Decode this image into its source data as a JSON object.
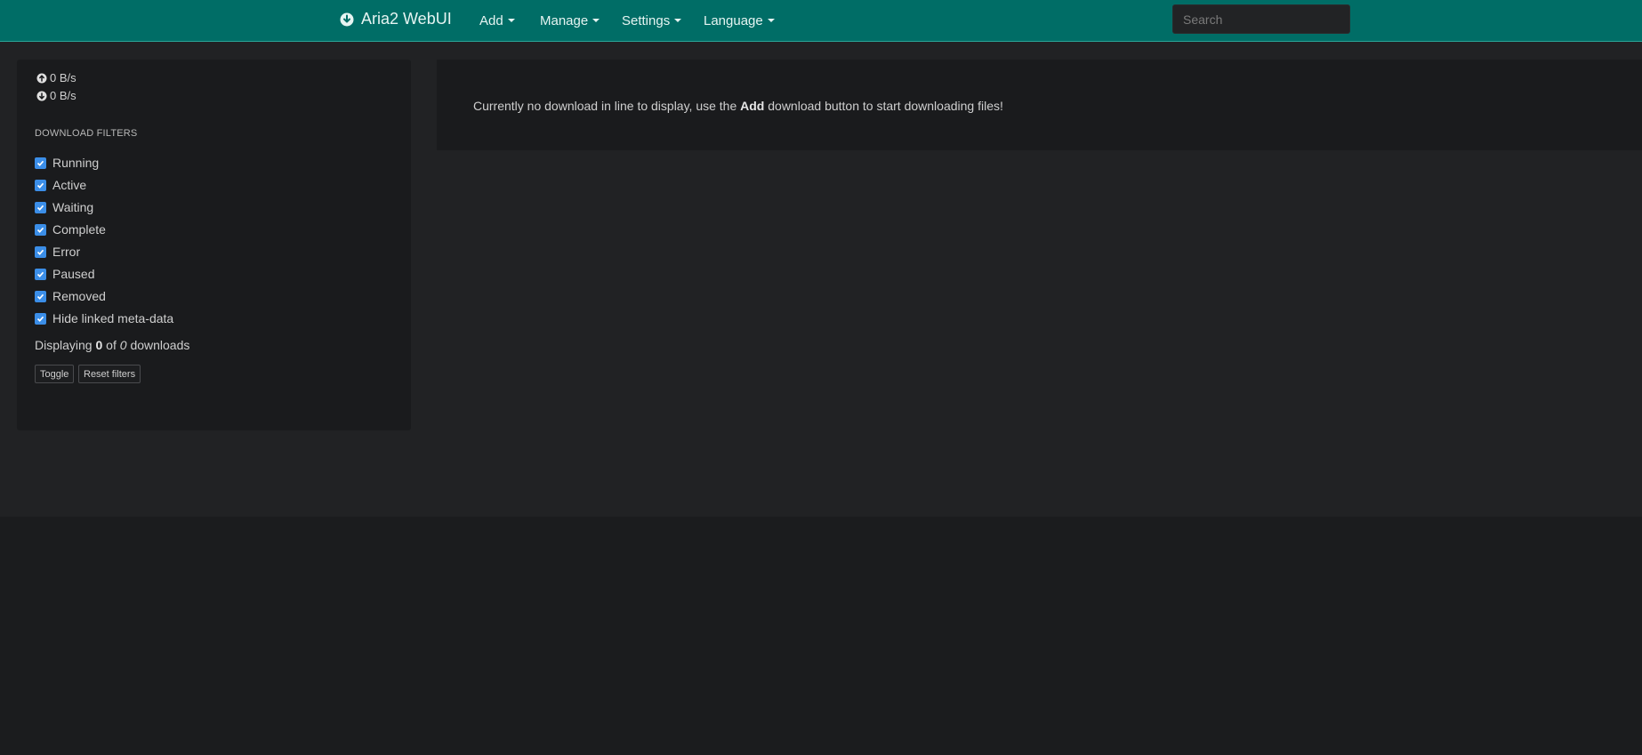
{
  "navbar": {
    "brand_label": "Aria2 WebUI",
    "brand_icon": "download-circle-icon",
    "menus": [
      {
        "label": "Add"
      },
      {
        "label": "Manage"
      },
      {
        "label": "Settings"
      },
      {
        "label": "Language"
      }
    ],
    "search": {
      "placeholder": "Search",
      "value": ""
    }
  },
  "sidebar": {
    "upload_speed": "0 B/s",
    "download_speed": "0 B/s",
    "filters_title": "DOWNLOAD FILTERS",
    "filters": [
      {
        "label": "Running",
        "checked": true
      },
      {
        "label": "Active",
        "checked": true
      },
      {
        "label": "Waiting",
        "checked": true
      },
      {
        "label": "Complete",
        "checked": true
      },
      {
        "label": "Error",
        "checked": true
      },
      {
        "label": "Paused",
        "checked": true
      },
      {
        "label": "Removed",
        "checked": true
      },
      {
        "label": "Hide linked meta-data",
        "checked": true
      }
    ],
    "displaying": {
      "prefix": "Displaying",
      "shown": "0",
      "of": "of",
      "total": "0",
      "suffix": "downloads"
    },
    "buttons": {
      "toggle": "Toggle",
      "reset": "Reset filters"
    }
  },
  "main": {
    "empty_prefix": "Currently no download in line to display, use the",
    "empty_bold": "Add",
    "empty_suffix": "download button to start downloading files!"
  },
  "colors": {
    "navbar": "#006d66",
    "checkbox": "#3b8ee8",
    "background": "#1b1c1e"
  }
}
